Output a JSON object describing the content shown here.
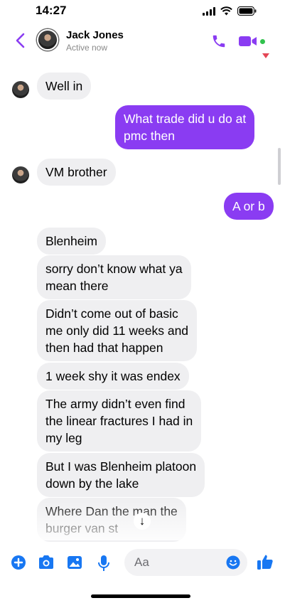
{
  "status_bar": {
    "time": "14:27",
    "signal_icon": "signal-bars",
    "wifi_icon": "wifi",
    "battery_icon": "battery"
  },
  "header": {
    "contact_name": "Jack Jones",
    "status": "Active now",
    "accent_color": "#8a3cf2",
    "icons": [
      "back-chevron",
      "phone",
      "video-camera"
    ]
  },
  "messages": [
    {
      "side": "in",
      "text": "Well in"
    },
    {
      "side": "out",
      "text": "What trade did u do at\npmc then"
    },
    {
      "side": "in",
      "text": "VM brother"
    },
    {
      "side": "out",
      "text": "A or b"
    },
    {
      "side": "in",
      "text": "Blenheim"
    },
    {
      "side": "in",
      "text": "sorry don’t know what ya\nmean there"
    },
    {
      "side": "in",
      "text": "Didn’t come out of basic\nme only did 11 weeks and\nthen had that happen"
    },
    {
      "side": "in",
      "text": "1 week shy it was endex"
    },
    {
      "side": "in",
      "text": "The army didn’t even find\nthe linear fractures I had in\nmy leg"
    },
    {
      "side": "in",
      "text": "But I was Blenheim platoon\ndown by the lake"
    },
    {
      "side": "in",
      "text": "Where Dan the man the\nburger van st"
    }
  ],
  "scroll_down": {
    "glyph": "↓"
  },
  "composer": {
    "placeholder": "Aa",
    "icons": [
      "plus",
      "camera",
      "photo",
      "microphone",
      "emoji",
      "thumbs-up"
    ]
  },
  "colors": {
    "outgoing_bubble": "#8a3cf2",
    "incoming_bubble": "#efeff1",
    "icon_blue": "#1877f2"
  }
}
